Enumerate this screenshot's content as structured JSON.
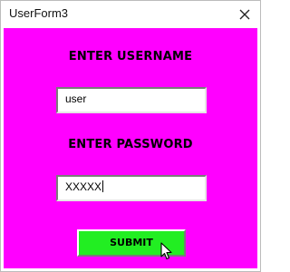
{
  "window": {
    "title": "UserForm3"
  },
  "form": {
    "background_color": "#ff00ff",
    "username_label": "Enter Username",
    "username_value": "user",
    "password_label": "Enter Password",
    "password_value": "XXXXX",
    "submit_label": "Submit",
    "submit_color": "#22ee22"
  },
  "icons": {
    "close": "close-icon",
    "pointer": "mouse-pointer-icon"
  }
}
